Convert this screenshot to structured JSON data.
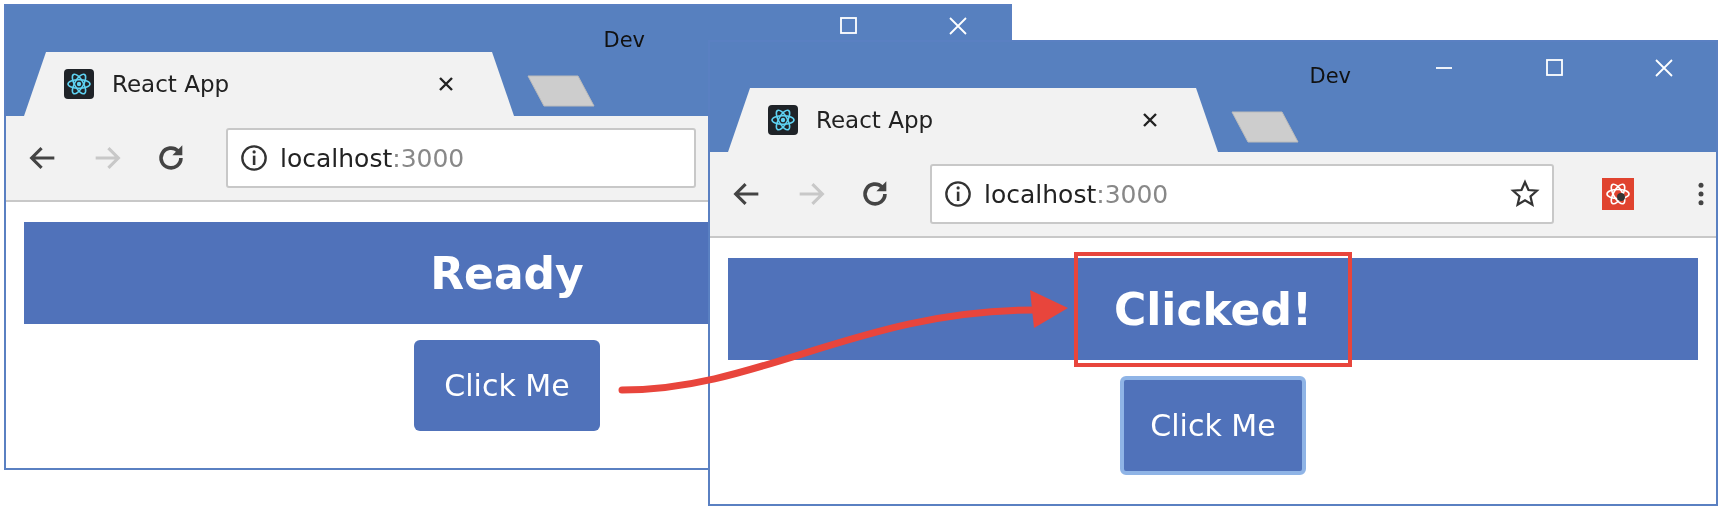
{
  "windows": [
    {
      "title": "Dev",
      "controls": [
        {
          "kind": "maximize"
        },
        {
          "kind": "close"
        }
      ],
      "tab": {
        "label": "React App",
        "selected": true
      },
      "url": {
        "host": "localhost",
        "port": ":3000"
      },
      "heading": {
        "text": "Ready",
        "highlighted": false
      },
      "button": {
        "label": "Click Me",
        "focused": false
      }
    },
    {
      "title": "Dev",
      "controls": [
        {
          "kind": "minimize"
        },
        {
          "kind": "maximize"
        },
        {
          "kind": "close"
        }
      ],
      "tab": {
        "label": "React App",
        "selected": true
      },
      "url": {
        "host": "localhost",
        "port": ":3000"
      },
      "toolbar_icons": [
        {
          "kind": "star"
        },
        {
          "kind": "extension"
        },
        {
          "kind": "menu"
        }
      ],
      "heading": {
        "text": "Clicked!",
        "highlighted": true
      },
      "button": {
        "label": "Click Me",
        "focused": true
      }
    }
  ]
}
